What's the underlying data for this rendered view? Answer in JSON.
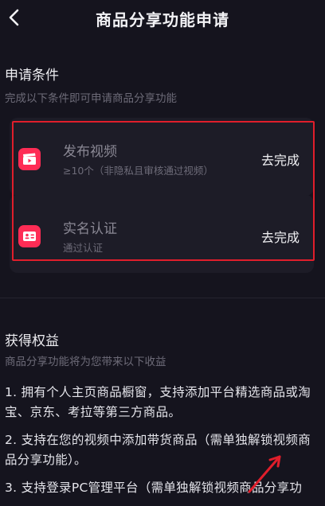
{
  "header": {
    "title": "商品分享功能申请"
  },
  "conditions": {
    "title": "申请条件",
    "subtitle": "完成以下条件即可申请商品分享功能",
    "items": [
      {
        "icon": "clapperboard-icon",
        "name": "发布视频",
        "desc": "≥10个（非隐私且审核通过视频）",
        "action": "去完成"
      },
      {
        "icon": "id-card-icon",
        "name": "实名认证",
        "desc": "通过认证",
        "action": "去完成"
      }
    ]
  },
  "benefits": {
    "title": "获得权益",
    "subtitle": "商品分享功能将为您带来以下收益",
    "items": [
      "1. 拥有个人主页商品橱窗，支持添加平台精选商品或淘宝、京东、考拉等第三方商品。",
      "2. 支持在您的视频中添加带货商品（需单独解锁视频商品分享功能）。",
      "3. 支持登录PC管理平台（需单独解锁视频商品分享功"
    ]
  },
  "colors": {
    "accent": "#fe2c55",
    "highlight": "#e01e2b",
    "background": "#15141e"
  }
}
